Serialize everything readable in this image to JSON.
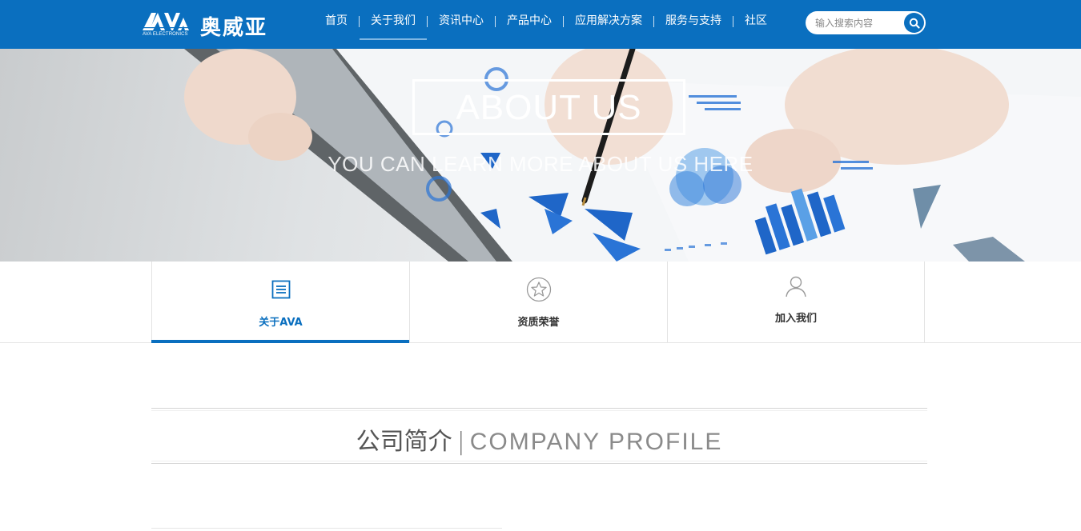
{
  "header": {
    "logo_mark_text": "AVA",
    "logo_sub": "AVA ELECTRONICS",
    "logo_cn": "奥威亚",
    "nav": [
      {
        "label": "首页",
        "active": false
      },
      {
        "label": "关于我们",
        "active": true
      },
      {
        "label": "资讯中心",
        "active": false
      },
      {
        "label": "产品中心",
        "active": false
      },
      {
        "label": "应用解决方案",
        "active": false
      },
      {
        "label": "服务与支持",
        "active": false
      },
      {
        "label": "社区",
        "active": false
      }
    ],
    "search": {
      "placeholder": "输入搜索内容",
      "value": ""
    }
  },
  "banner": {
    "title": "ABOUT US",
    "subtitle": "YOU CAN LEARN MORE ABOUT US HERE"
  },
  "subtabs": [
    {
      "label": "关于AVA",
      "icon": "list-icon",
      "active": true
    },
    {
      "label": "资质荣誉",
      "icon": "star-icon",
      "active": false
    },
    {
      "label": "加入我们",
      "icon": "person-icon",
      "active": false
    }
  ],
  "section": {
    "title_cn": "公司简介",
    "separator": "|",
    "title_en": "COMPANY PROFILE"
  },
  "colors": {
    "brand_blue": "#0a6fbf",
    "text_dark": "#333333",
    "divider": "#d5d5d5"
  }
}
